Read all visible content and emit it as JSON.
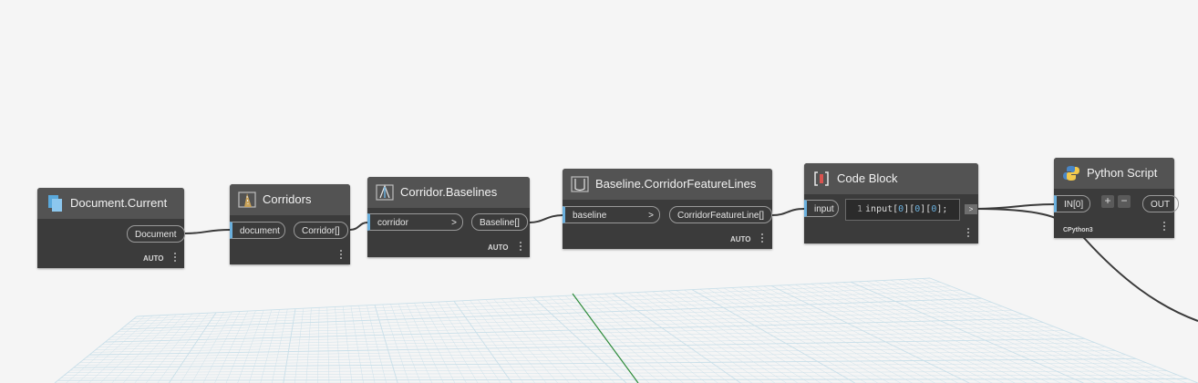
{
  "nodes": {
    "document_current": {
      "title": "Document.Current",
      "output": "Document",
      "lacing": "AUTO"
    },
    "corridors": {
      "title": "Corridors",
      "input": "document",
      "output": "Corridor[]"
    },
    "corridor_baselines": {
      "title": "Corridor.Baselines",
      "input": "corridor",
      "output": "Baseline[]",
      "lacing": "AUTO"
    },
    "baseline_featurelines": {
      "title": "Baseline.CorridorFeatureLines",
      "input": "baseline",
      "output": "CorridorFeatureLine[]",
      "lacing": "AUTO"
    },
    "code_block": {
      "title": "Code Block",
      "input": "input",
      "line_number": "1",
      "code_parts": [
        "input[",
        "0",
        "][",
        "0",
        "][",
        "0",
        "];"
      ],
      "out_arrow": ">"
    },
    "python_script": {
      "title": "Python Script",
      "input": "IN[0]",
      "add_label": "+",
      "remove_label": "−",
      "output": "OUT",
      "engine": "CPython3"
    }
  },
  "glyphs": {
    "chevron": ">"
  },
  "colors": {
    "canvas_bg": "#f5f5f5",
    "node_body": "#3b3b3b",
    "node_header": "#535353",
    "port_accent": "#6ab0de",
    "wire": "#3a3a3a",
    "grid_line": "#c9dfe9",
    "axis_green": "#2e8b3a"
  },
  "icons": {
    "document_current": "document-icon",
    "corridors": "road-icon",
    "corridor_baselines": "baselines-icon",
    "baseline_featurelines": "featureline-icon",
    "code_block": "code-brackets-icon",
    "python_script": "python-logo-icon"
  }
}
